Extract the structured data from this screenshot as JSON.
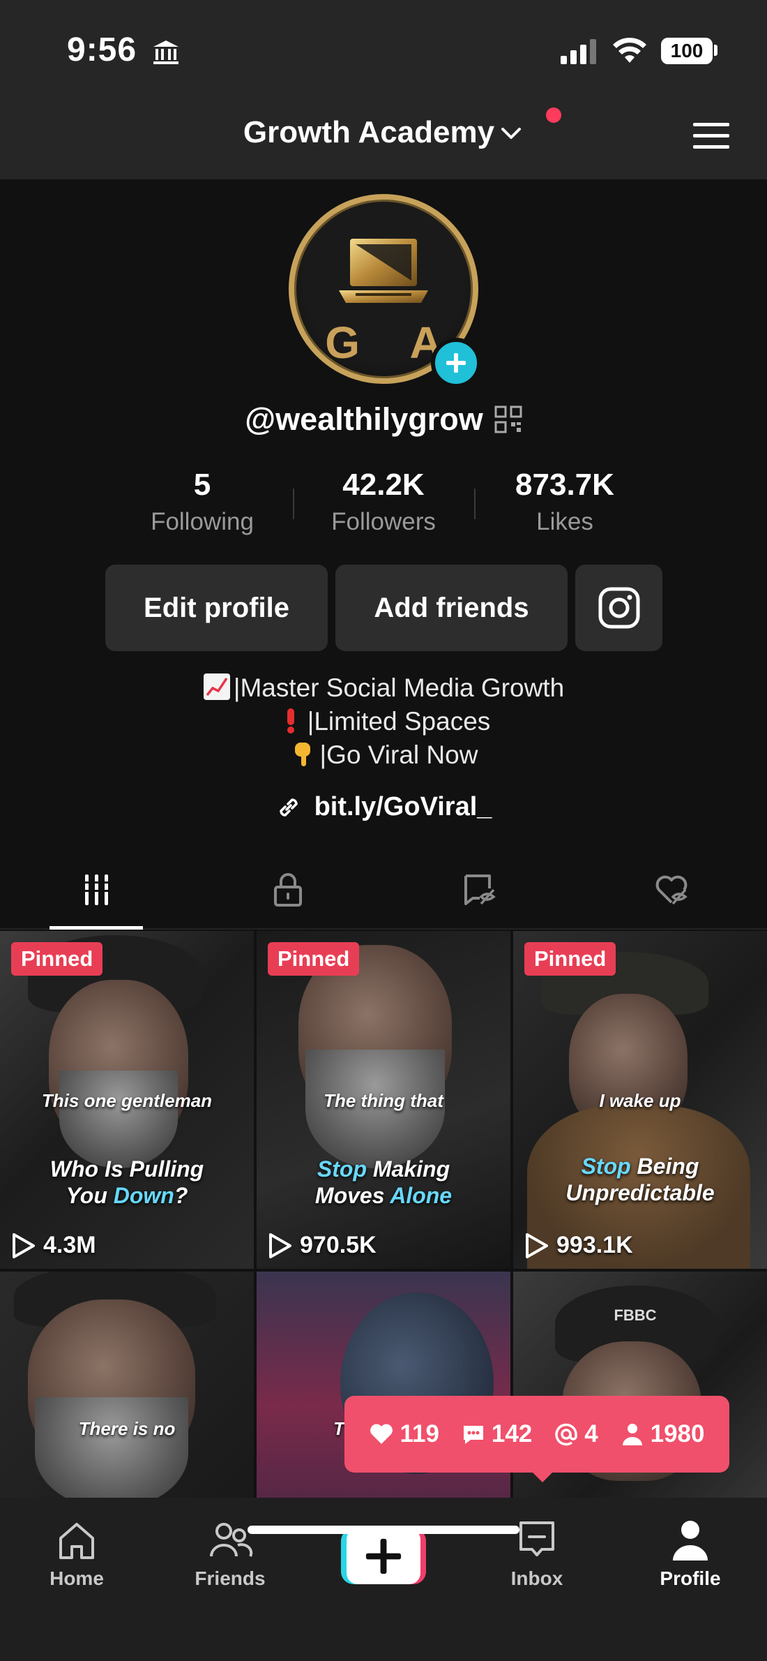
{
  "status_bar": {
    "time": "9:56",
    "battery": "100"
  },
  "header": {
    "title": "Growth Academy"
  },
  "profile": {
    "avatar_letters": "G A",
    "username": "@wealthilygrow",
    "stats": [
      {
        "value": "5",
        "label": "Following"
      },
      {
        "value": "42.2K",
        "label": "Followers"
      },
      {
        "value": "873.7K",
        "label": "Likes"
      }
    ],
    "edit_label": "Edit profile",
    "add_friends_label": "Add friends",
    "bio": [
      "|Master Social Media Growth",
      "|Limited Spaces",
      "|Go Viral Now"
    ],
    "link": "bit.ly/GoViral_"
  },
  "tabs": [
    "videos",
    "private",
    "reposts",
    "liked"
  ],
  "videos": [
    {
      "pinned": "Pinned",
      "caption_small": "This one gentleman",
      "caption_a": "Who Is Pulling",
      "caption_b_pre": "You ",
      "caption_b_hl": "Down",
      "caption_b_post": "?",
      "views": "4.3M"
    },
    {
      "pinned": "Pinned",
      "caption_small": "The thing that",
      "caption_a_hl": "Stop",
      "caption_a": " Making",
      "caption_b_pre": "Moves ",
      "caption_b_hl": "Alone",
      "caption_b_post": "",
      "views": "970.5K"
    },
    {
      "pinned": "Pinned",
      "caption_small": "I wake up",
      "caption_a_hl": "Stop",
      "caption_a": " Being",
      "caption_b_pre": "Unpredictable",
      "caption_b_hl": "",
      "caption_b_post": "",
      "views": "993.1K"
    },
    {
      "caption_small": "There is no"
    },
    {
      "caption_small": "T"
    },
    {
      "cap_text": "FBBC"
    }
  ],
  "notification": {
    "likes": "119",
    "comments": "142",
    "mentions": "4",
    "followers": "1980"
  },
  "bottom_nav": [
    {
      "label": "Home"
    },
    {
      "label": "Friends"
    },
    {
      "label": ""
    },
    {
      "label": "Inbox"
    },
    {
      "label": "Profile"
    }
  ],
  "colors": {
    "pin": "#e83e55",
    "notif": "#f0506b",
    "accent_cyan": "#29d5e6",
    "accent_pink": "#ef3f6a",
    "gold": "#c7a25a"
  }
}
